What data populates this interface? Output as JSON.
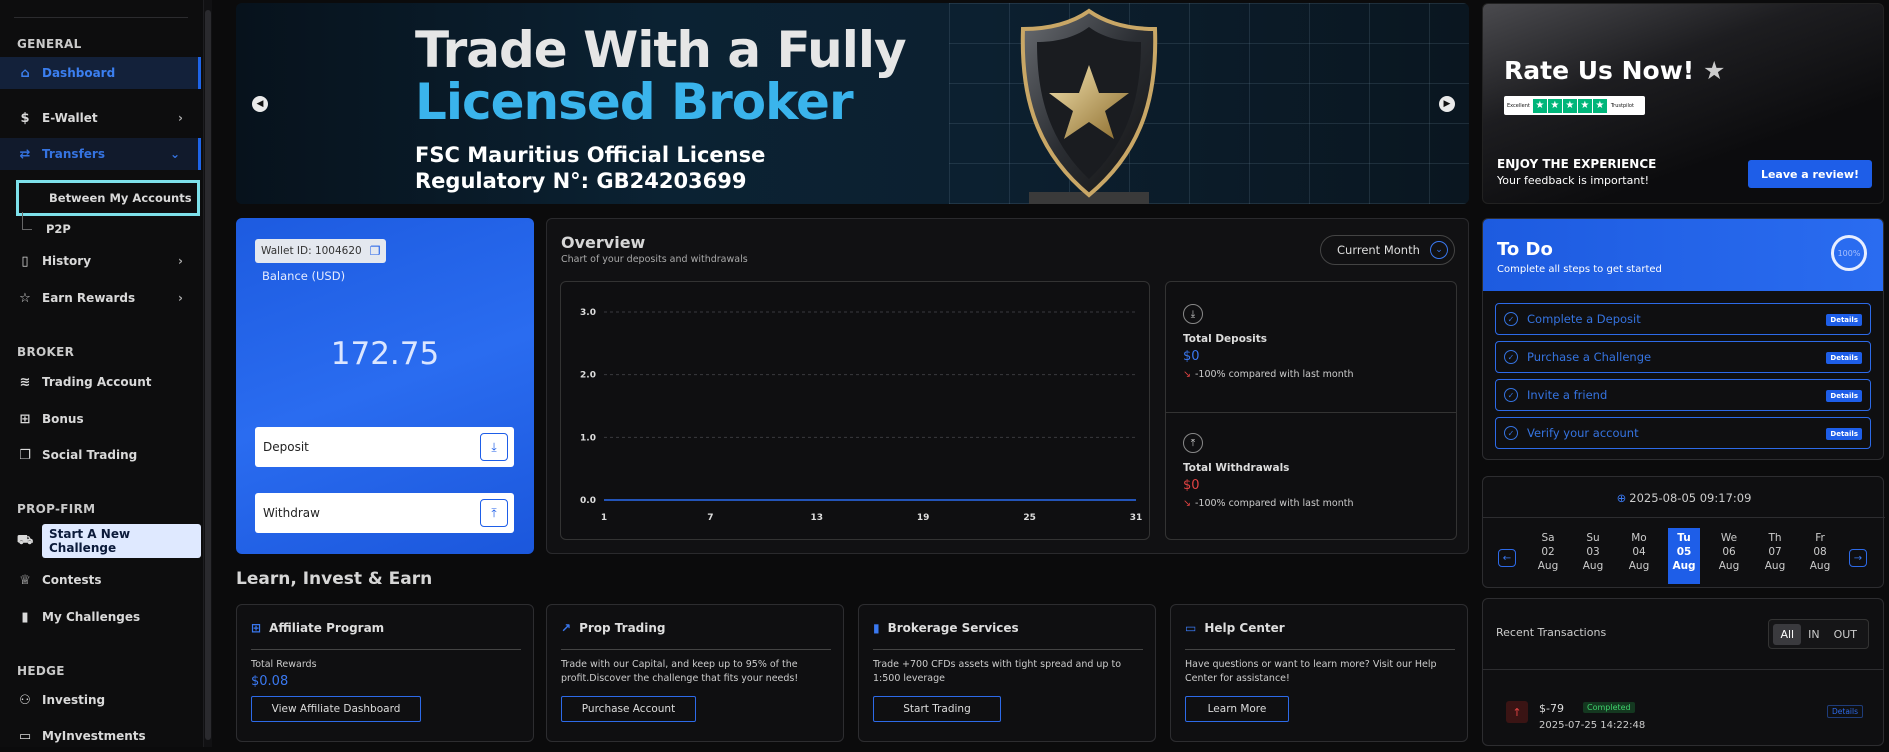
{
  "sidebar": {
    "sections": {
      "general": "GENERAL",
      "broker": "BROKER",
      "propfirm": "PROP-FIRM",
      "hedge": "HEDGE"
    },
    "items": {
      "dashboard": "Dashboard",
      "ewallet": "E-Wallet",
      "transfers": "Transfers",
      "between_accounts": "Between My Accounts",
      "p2p": "P2P",
      "history": "History",
      "earn_rewards": "Earn Rewards",
      "trading_account": "Trading Account",
      "bonus": "Bonus",
      "social_trading": "Social Trading",
      "start_challenge": "Start A New Challenge",
      "contests": "Contests",
      "my_challenges": "My Challenges",
      "investing": "Investing",
      "my_investments": "MyInvestments"
    }
  },
  "banner": {
    "line1": "Trade With a Fully",
    "line2": "Licensed Broker",
    "line3": "FSC Mauritius Official License",
    "line4": "Regulatory N°: GB24203699",
    "colors": {
      "accent": "#3ab4ec"
    }
  },
  "rate": {
    "title": "Rate Us Now!",
    "trustpilot_left": "Excellent",
    "trustpilot_right": "Trustpilot",
    "enjoy": "ENJOY THE EXPERIENCE",
    "feedback": "Your feedback is important!",
    "button": "Leave a review!"
  },
  "wallet": {
    "id_label": "Wallet ID: 1004620",
    "balance_label": "Balance (USD)",
    "amount": "172.75",
    "deposit": "Deposit",
    "withdraw": "Withdraw"
  },
  "overview": {
    "title": "Overview",
    "subtitle": "Chart of your deposits and withdrawals",
    "period": "Current Month",
    "deposits_label": "Total Deposits",
    "deposits_value": "$0",
    "deposits_change": "-100% compared with last month",
    "withdrawals_label": "Total Withdrawals",
    "withdrawals_value": "$0",
    "withdrawals_change": "-100% compared with last month"
  },
  "chart_data": {
    "type": "line",
    "x": [
      1,
      7,
      13,
      19,
      25,
      31
    ],
    "x_ticks": [
      "1",
      "7",
      "13",
      "19",
      "25",
      "31"
    ],
    "y_ticks": [
      "0.0",
      "1.0",
      "2.0",
      "3.0"
    ],
    "ylim": [
      0,
      3
    ],
    "xlim": [
      1,
      31
    ],
    "grid": true,
    "series": [
      {
        "values": [
          0,
          0,
          0,
          0,
          0,
          0
        ],
        "color": "#2a6cf0"
      }
    ]
  },
  "learn": {
    "title": "Learn, Invest & Earn",
    "cards": [
      {
        "title": "Affiliate Program",
        "text": "Total Rewards",
        "value": "$0.08",
        "button": "View Affiliate Dashboard"
      },
      {
        "title": "Prop Trading",
        "text": "Trade with our Capital, and keep up to 95% of the profit.Discover the challenge that fits your needs!",
        "button": "Purchase Account"
      },
      {
        "title": "Brokerage Services",
        "text": "Trade +700 CFDs assets with tight spread and up to 1:500 leverage",
        "button": "Start Trading"
      },
      {
        "title": "Help Center",
        "text": "Have questions or want to learn more? Visit our Help Center for assistance!",
        "button": "Learn More"
      }
    ]
  },
  "todo": {
    "title": "To Do",
    "subtitle": "Complete all steps to get started",
    "progress": "100%",
    "tasks": [
      {
        "label": "Complete a Deposit",
        "action": "Details"
      },
      {
        "label": "Purchase a Challenge",
        "action": "Details"
      },
      {
        "label": "Invite a friend",
        "action": "Details"
      },
      {
        "label": "Verify your account",
        "action": "Details"
      }
    ]
  },
  "calendar": {
    "datetime": "2025-08-05 09:17:09",
    "days": [
      {
        "dow": "Sa",
        "num": "02",
        "mon": "Aug"
      },
      {
        "dow": "Su",
        "num": "03",
        "mon": "Aug"
      },
      {
        "dow": "Mo",
        "num": "04",
        "mon": "Aug"
      },
      {
        "dow": "Tu",
        "num": "05",
        "mon": "Aug"
      },
      {
        "dow": "We",
        "num": "06",
        "mon": "Aug"
      },
      {
        "dow": "Th",
        "num": "07",
        "mon": "Aug"
      },
      {
        "dow": "Fr",
        "num": "08",
        "mon": "Aug"
      }
    ]
  },
  "transactions": {
    "title": "Recent Transactions",
    "filters": [
      "All",
      "IN",
      "OUT"
    ],
    "items": [
      {
        "amount": "$-79",
        "status": "Completed",
        "date": "2025-07-25 14:22:48",
        "action": "Details"
      }
    ]
  }
}
